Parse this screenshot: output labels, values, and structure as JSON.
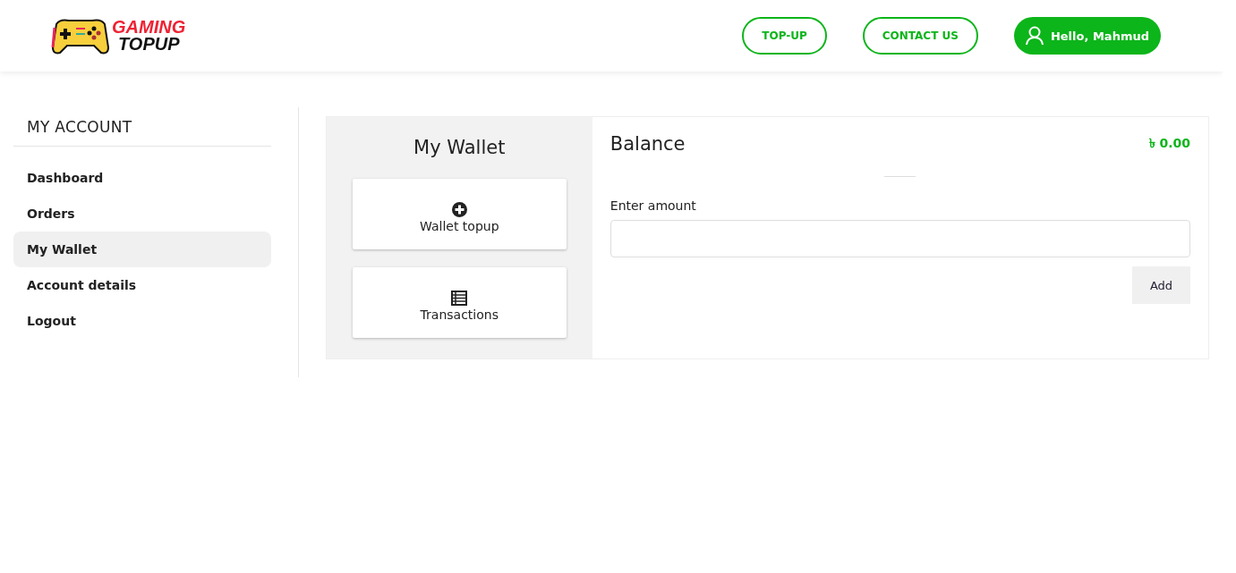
{
  "header": {
    "logo": {
      "line_1": "GAMING",
      "line_2": "TOPUP"
    },
    "nav": [
      {
        "label": "TOP-UP",
        "kind": "outline"
      },
      {
        "label": "CONTACT US",
        "kind": "outline"
      },
      {
        "label": "Hello, Mahmud",
        "kind": "user"
      }
    ]
  },
  "sidebar": {
    "title": "MY ACCOUNT",
    "items": [
      {
        "label": "Dashboard",
        "selected": false
      },
      {
        "label": "Orders",
        "selected": false
      },
      {
        "label": "My Wallet",
        "selected": true
      },
      {
        "label": "Account details",
        "selected": false
      },
      {
        "label": "Logout",
        "selected": false
      }
    ]
  },
  "wallet": {
    "title": "My Wallet",
    "options": [
      {
        "label": "Wallet topup",
        "kind": "plus"
      },
      {
        "label": "Transactions",
        "kind": "list"
      }
    ]
  },
  "balance": {
    "title": "Balance",
    "amount": "৳ 0.00",
    "field_label": "Enter amount",
    "button": "Add"
  }
}
